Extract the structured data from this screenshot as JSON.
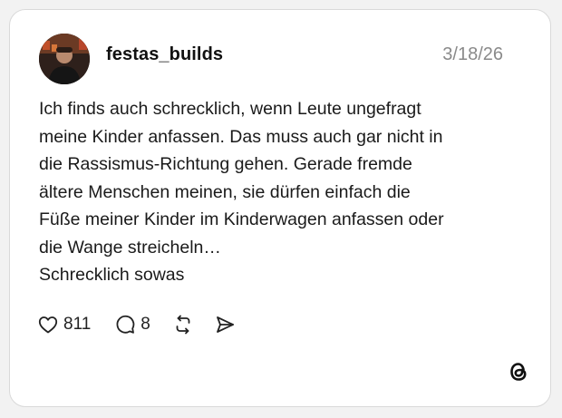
{
  "post": {
    "username": "festas_builds",
    "date": "3/18/26",
    "lines": [
      "Ich finds auch schrecklich, wenn Leute ungefragt",
      "meine Kinder anfassen. Das muss auch gar nicht in",
      "die Rassismus-Richtung gehen. Gerade fremde",
      "ältere Menschen meinen, sie dürfen einfach die",
      "Füße meiner Kinder im Kinderwagen anfassen oder",
      "die Wange streicheln…",
      "Schrecklich sowas"
    ],
    "likes": "811",
    "replies": "8"
  },
  "icons": {
    "like": "heart-icon",
    "reply": "comment-icon",
    "repost": "repost-icon",
    "share": "send-icon",
    "brand": "threads-logo-icon"
  },
  "colors": {
    "background": "#f2f2f2",
    "card": "#ffffff",
    "border": "#d9d9d9",
    "date": "#8a8a8a",
    "text": "#1a1a1a"
  }
}
